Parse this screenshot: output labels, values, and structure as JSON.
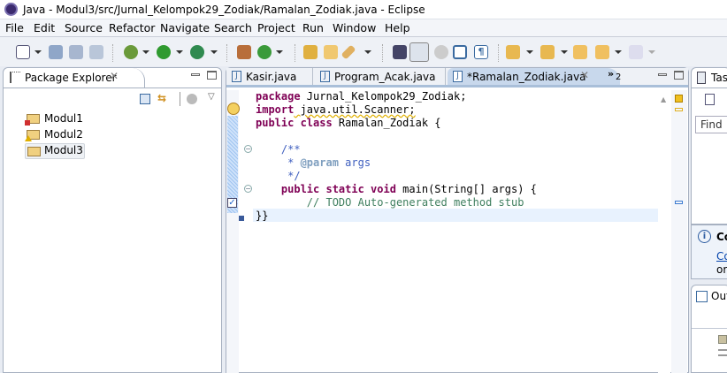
{
  "window": {
    "title": "Java - Modul3/src/Jurnal_Kelompok29_Zodiak/Ramalan_Zodiak.java - Eclipse"
  },
  "menu": [
    "File",
    "Edit",
    "Source",
    "Refactor",
    "Navigate",
    "Search",
    "Project",
    "Run",
    "Window",
    "Help"
  ],
  "package_explorer": {
    "title": "Package Explorer",
    "items": [
      {
        "label": "Modul1",
        "status": "error"
      },
      {
        "label": "Modul2",
        "status": "warning"
      },
      {
        "label": "Modul3",
        "status": "selected"
      }
    ]
  },
  "editor": {
    "tabs": [
      {
        "label": "Kasir.java"
      },
      {
        "label": "Program_Acak.java"
      },
      {
        "label": "*Ramalan_Zodiak.java",
        "active": true
      }
    ],
    "overflow_count": "2",
    "lines": {
      "l1a": "package",
      "l1b": " Jurnal_Kelompok29_Zodiak;",
      "l2a": "import",
      "l2b": " java.util.Scanner;",
      "l3a": "public class",
      "l3b": " Ramalan_Zodiak {",
      "l5": "    /**",
      "l6a": "     * ",
      "l6b": "@param",
      "l6c": " args",
      "l7": "     */",
      "l8a": "    public static void",
      "l8b": " main(String[] args) {",
      "l9": "        // TODO Auto-generated method stub",
      "l10": "}}"
    }
  },
  "right": {
    "task_title": "Tas",
    "find_placeholder": "Find",
    "info_title": "Co",
    "info_link": "Co",
    "info_text": "or",
    "outline_title": "Out"
  },
  "colors": {
    "accent": "#7f0055",
    "selection": "#e8f2fe"
  }
}
